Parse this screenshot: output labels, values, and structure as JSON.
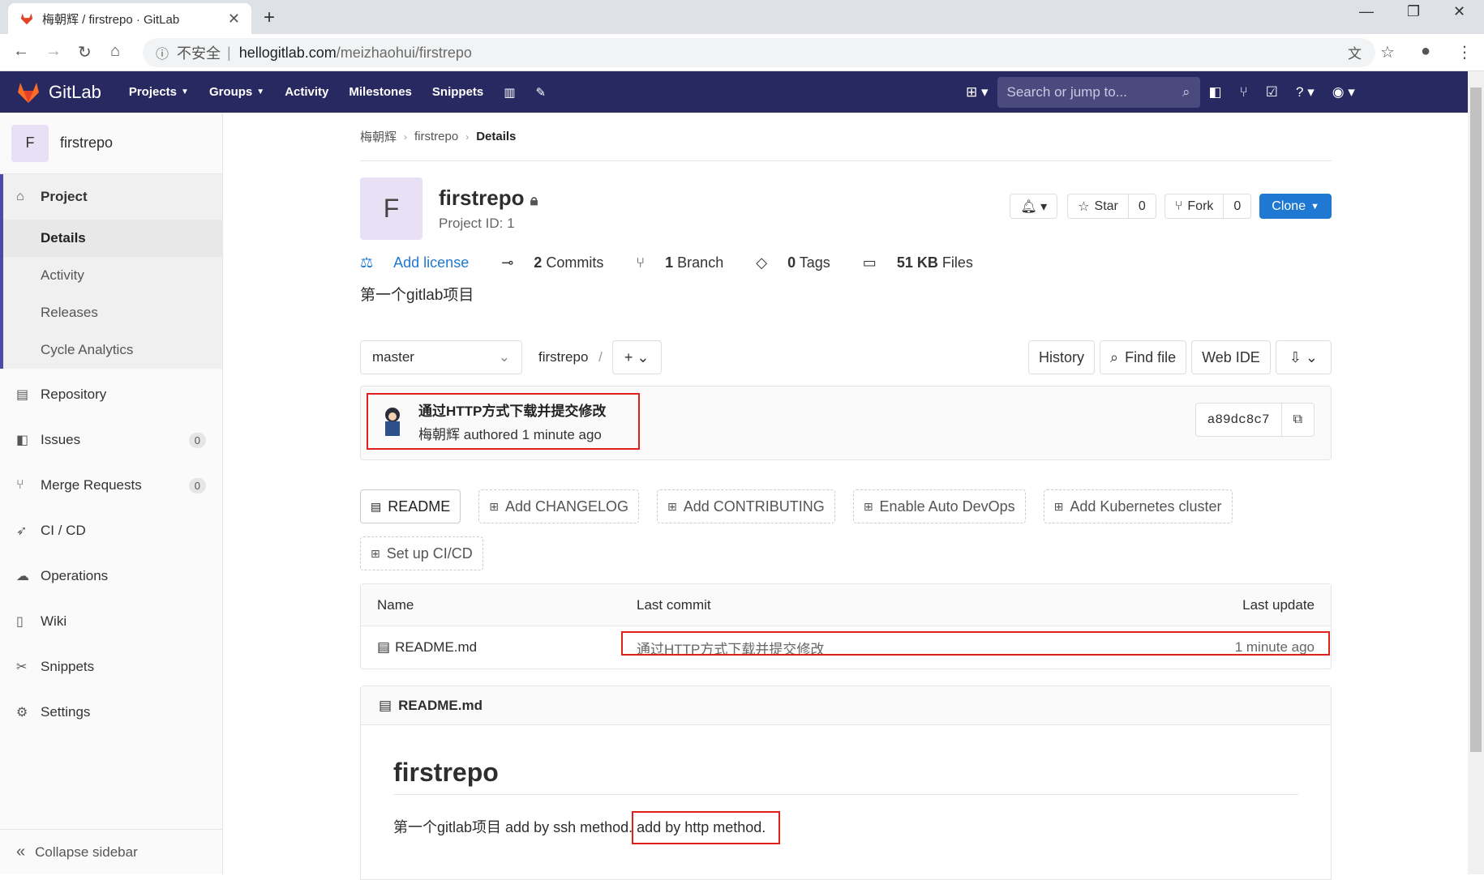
{
  "browser": {
    "tab_title": "梅朝辉 / firstrepo · GitLab",
    "insecure_label": "不安全",
    "url_host": "hellogitlab.com",
    "url_path": "/meizhaohui/firstrepo"
  },
  "nav": {
    "brand": "GitLab",
    "menu": [
      "Projects",
      "Groups",
      "Activity",
      "Milestones",
      "Snippets"
    ],
    "search_placeholder": "Search or jump to..."
  },
  "sidebar": {
    "project_initial": "F",
    "project_name": "firstrepo",
    "project_label": "Project",
    "project_sub": [
      "Details",
      "Activity",
      "Releases",
      "Cycle Analytics"
    ],
    "items": [
      {
        "label": "Repository",
        "icon": "repository-icon"
      },
      {
        "label": "Issues",
        "count": "0",
        "icon": "issues-icon"
      },
      {
        "label": "Merge Requests",
        "count": "0",
        "icon": "merge-request-icon"
      },
      {
        "label": "CI / CD",
        "icon": "rocket-icon"
      },
      {
        "label": "Operations",
        "icon": "cloud-gear-icon"
      },
      {
        "label": "Wiki",
        "icon": "book-icon"
      },
      {
        "label": "Snippets",
        "icon": "scissors-icon"
      },
      {
        "label": "Settings",
        "icon": "gear-icon"
      }
    ],
    "collapse": "Collapse sidebar"
  },
  "breadcrumb": [
    "梅朝辉",
    "firstrepo",
    "Details"
  ],
  "project": {
    "initial": "F",
    "name": "firstrepo",
    "id_label": "Project ID: 1",
    "star_label": "Star",
    "star_count": "0",
    "fork_label": "Fork",
    "fork_count": "0",
    "clone_label": "Clone",
    "add_license": "Add license",
    "commits_num": "2",
    "commits_label": "Commits",
    "branch_num": "1",
    "branch_label": "Branch",
    "tags_num": "0",
    "tags_label": "Tags",
    "files_size": "51 KB",
    "files_label": "Files",
    "description": "第一个gitlab项目"
  },
  "toolbar": {
    "branch": "master",
    "path": "firstrepo",
    "history": "History",
    "find_file": "Find file",
    "web_ide": "Web IDE"
  },
  "last_commit": {
    "title": "通过HTTP方式下载并提交修改",
    "author": "梅朝辉",
    "meta": "authored 1 minute ago",
    "sha": "a89dc8c7"
  },
  "quick_actions": [
    "README",
    "Add CHANGELOG",
    "Add CONTRIBUTING",
    "Enable Auto DevOps",
    "Add Kubernetes cluster",
    "Set up CI/CD"
  ],
  "file_table": {
    "headers": [
      "Name",
      "Last commit",
      "Last update"
    ],
    "rows": [
      {
        "name": "README.md",
        "commit": "通过HTTP方式下载并提交修改",
        "updated": "1 minute ago"
      }
    ]
  },
  "readme": {
    "filename": "README.md",
    "title": "firstrepo",
    "text_part1": "第一个gitlab项目 add by ssh method.",
    "text_part2": "add by http method."
  },
  "colors": {
    "nav_bg": "#292961",
    "accent_blue": "#1f78d1",
    "highlight_red": "#e0201b"
  }
}
